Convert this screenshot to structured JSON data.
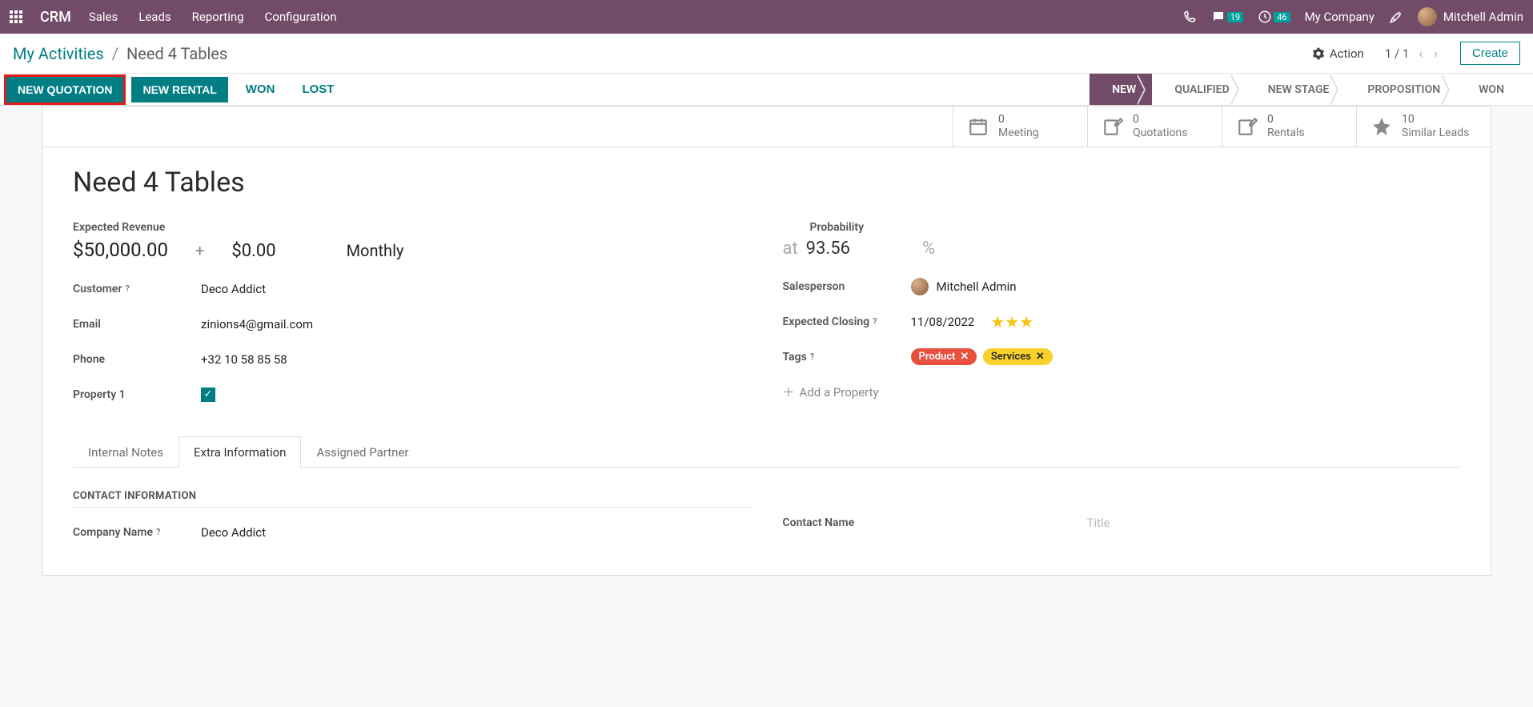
{
  "navbar": {
    "brand": "CRM",
    "menu": [
      "Sales",
      "Leads",
      "Reporting",
      "Configuration"
    ],
    "messages_badge": "19",
    "activities_badge": "46",
    "company": "My Company",
    "user": "Mitchell Admin"
  },
  "header": {
    "breadcrumb_root": "My Activities",
    "breadcrumb_current": "Need 4 Tables",
    "action_label": "Action",
    "pager": "1 / 1",
    "create_label": "Create"
  },
  "statusbar": {
    "new_quotation": "NEW QUOTATION",
    "new_rental": "NEW RENTAL",
    "won": "WON",
    "lost": "LOST",
    "stages": [
      "NEW",
      "QUALIFIED",
      "NEW STAGE",
      "PROPOSITION",
      "WON"
    ],
    "active_stage_index": 0
  },
  "stats": {
    "meeting": {
      "num": "0",
      "label": "Meeting"
    },
    "quotations": {
      "num": "0",
      "label": "Quotations"
    },
    "rentals": {
      "num": "0",
      "label": "Rentals"
    },
    "similar": {
      "num": "10",
      "label": "Similar Leads"
    }
  },
  "record": {
    "title": "Need 4 Tables",
    "expected_revenue_label": "Expected Revenue",
    "revenue_amount": "$50,000.00",
    "revenue_recurring": "$0.00",
    "revenue_period": "Monthly",
    "probability_label": "Probability",
    "probability_at": "at",
    "probability_value": "93.56",
    "probability_pct": "%",
    "customer_label": "Customer",
    "customer_value": "Deco Addict",
    "email_label": "Email",
    "email_value": "zinions4@gmail.com",
    "phone_label": "Phone",
    "phone_value": "+32 10 58 85 58",
    "property1_label": "Property 1",
    "salesperson_label": "Salesperson",
    "salesperson_value": "Mitchell Admin",
    "expected_closing_label": "Expected Closing",
    "expected_closing_value": "11/08/2022",
    "tags_label": "Tags",
    "tags": [
      {
        "name": "Product",
        "color": "red"
      },
      {
        "name": "Services",
        "color": "yellow"
      }
    ],
    "add_property": "Add a Property"
  },
  "tabs": {
    "items": [
      "Internal Notes",
      "Extra Information",
      "Assigned Partner"
    ],
    "active_index": 1
  },
  "contact_section": {
    "title": "CONTACT INFORMATION",
    "company_name_label": "Company Name",
    "company_name_value": "Deco Addict",
    "contact_name_label": "Contact Name",
    "contact_title_placeholder": "Title"
  }
}
